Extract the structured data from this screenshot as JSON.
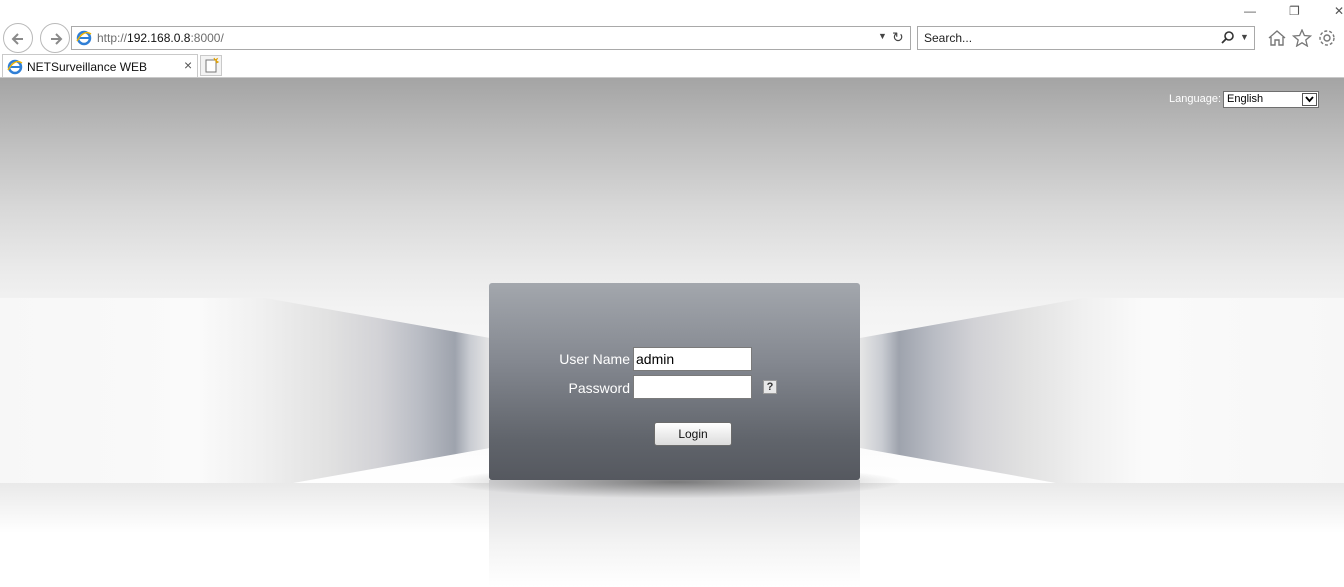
{
  "browser": {
    "window_controls": {
      "minimize": "—",
      "restore": "❐",
      "close": "✕"
    },
    "address": {
      "scheme": "http://",
      "host": "192.168.0.8",
      "port": ":8000/"
    },
    "search": {
      "placeholder": "Search..."
    },
    "tab": {
      "title": "NETSurveillance WEB",
      "close": "×"
    }
  },
  "page": {
    "language": {
      "label": "Language:",
      "selected": "English"
    },
    "login_form": {
      "username_label": "User Name",
      "username_value": "admin",
      "password_label": "Password",
      "password_value": "",
      "help_label": "?",
      "login_button": "Login"
    }
  }
}
